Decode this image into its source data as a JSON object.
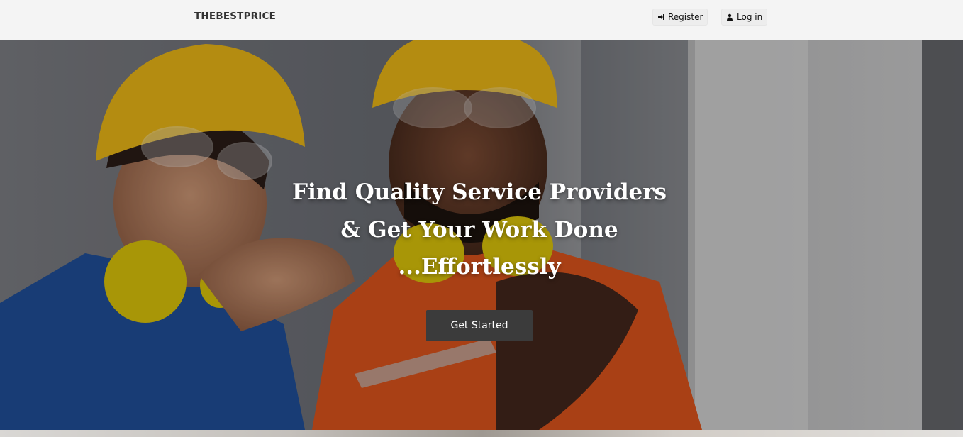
{
  "navbar": {
    "brand": "THEBESTPRICE",
    "register_label": "Register",
    "login_label": "Log in",
    "register_icon": "sign-in-icon",
    "login_icon": "user-icon"
  },
  "hero": {
    "headline_lines": [
      "Find Quality Service Providers",
      "& Get Your Work Done",
      "...Effortlessly"
    ],
    "cta_label": "Get Started",
    "background": "hero-image-construction-workers"
  },
  "colors": {
    "nav_bg": "#f4f4f4",
    "cta_bg": "#3b3b3b",
    "headline": "#ffffff",
    "hard_hat": "#e7b416",
    "blue_uniform": "#1f4e96",
    "orange_uniform": "#d9531c"
  }
}
